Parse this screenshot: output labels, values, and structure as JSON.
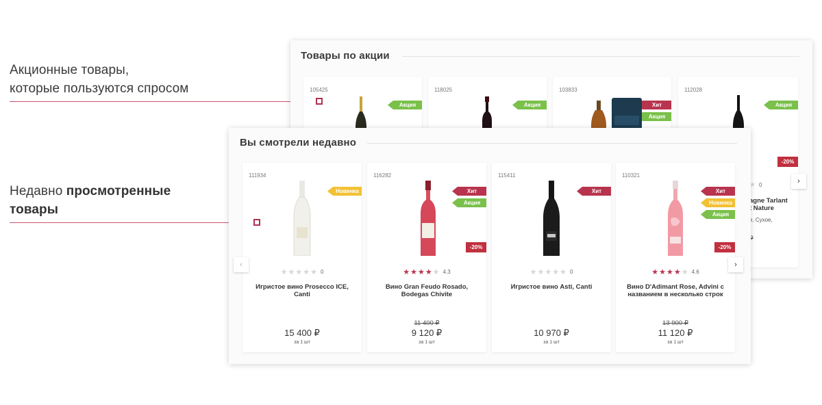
{
  "annotations": {
    "promo": {
      "line1": "Акционные товары,",
      "line2": "которые пользуются спросом"
    },
    "recent": {
      "line1_regular": "Недавно ",
      "line1_bold": "просмотренные",
      "line2_bold": "товары"
    }
  },
  "promo_panel": {
    "title": "Товары по акции",
    "cards": [
      {
        "sku": "105425",
        "tags": [
          "Акция"
        ]
      },
      {
        "sku": "118025",
        "tags": [
          "Акция"
        ]
      },
      {
        "sku": "103833",
        "tags": [
          "Хит",
          "Акция"
        ]
      },
      {
        "sku": "112028",
        "tags": [
          "Акция"
        ],
        "discount": "-20%",
        "rating_value": "0",
        "name_line1": "agne Tarlant",
        "name_line2": "t Nature",
        "desc": "е, Сухое,",
        "old_price_partial": "₽"
      }
    ],
    "next_icon": "chevron-right-icon"
  },
  "recent_panel": {
    "title": "Вы смотрели недавно",
    "prev_icon": "chevron-left-icon",
    "next_icon": "chevron-right-icon",
    "unit_label": "за 1 шт",
    "cards": [
      {
        "sku": "111934",
        "tags": [
          "Новинка"
        ],
        "rating": 0,
        "rating_value": "0",
        "name": "Игристое вино Prosecco ICE, Canti",
        "old_price": "",
        "price": "15 400 ₽",
        "discount": ""
      },
      {
        "sku": "116282",
        "tags": [
          "Хит",
          "Акция"
        ],
        "rating": 4,
        "rating_value": "4.3",
        "name": "Вино Gran Feudo Rosado, Bodegas Chivite",
        "old_price": "11 400 ₽",
        "price": "9 120 ₽",
        "discount": "-20%"
      },
      {
        "sku": "115411",
        "tags": [
          "Хит"
        ],
        "rating": 0,
        "rating_value": "0",
        "name": "Игристое вино Asti, Canti",
        "old_price": "",
        "price": "10 970 ₽",
        "discount": ""
      },
      {
        "sku": "110321",
        "tags": [
          "Хит",
          "Новинка",
          "Акция"
        ],
        "rating": 4,
        "rating_value": "4.6",
        "name": "Вино D'Adimant Rose, Advini с названием в несколько строк",
        "old_price": "13 900 ₽",
        "price": "11 120 ₽",
        "discount": "-20%"
      }
    ]
  },
  "colors": {
    "accent": "#b8344e",
    "hit": "#b8344e",
    "promo": "#7ac04a",
    "new": "#f2c134",
    "discount": "#c0303f"
  }
}
